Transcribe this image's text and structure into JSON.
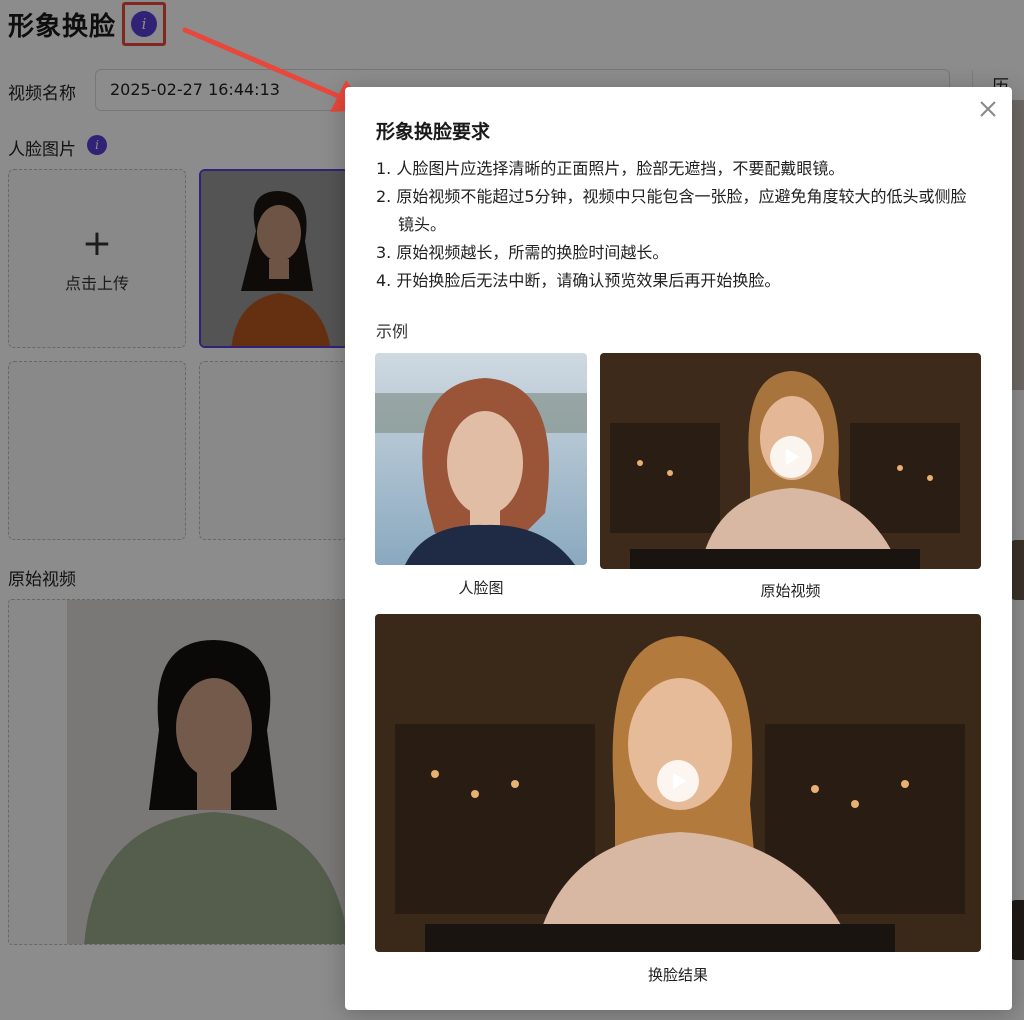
{
  "header": {
    "title": "形象换脸",
    "info_icon": "info-icon"
  },
  "form": {
    "video_name_label": "视频名称",
    "video_name_value": "2025-02-27 16:44:13",
    "face_image_label": "人脸图片",
    "upload_text": "点击上传",
    "original_video_label": "原始视频",
    "history_label": "历史"
  },
  "modal": {
    "title": "形象换脸要求",
    "requirements": [
      "1. 人脸图片应选择清晰的正面照片，脸部无遮挡，不要配戴眼镜。",
      "2. 原始视频不能超过5分钟，视频中只能包含一张脸，应避免角度较大的低头或侧脸镜头。",
      "3. 原始视频越长，所需的换脸时间越长。",
      "4. 开始换脸后无法中断，请确认预览效果后再开始换脸。"
    ],
    "example_label": "示例",
    "captions": {
      "face": "人脸图",
      "original": "原始视频",
      "result": "换脸结果"
    }
  },
  "colors": {
    "accent": "#5b3fd6",
    "highlight": "#e8483b",
    "arrow": "#e8483b"
  }
}
